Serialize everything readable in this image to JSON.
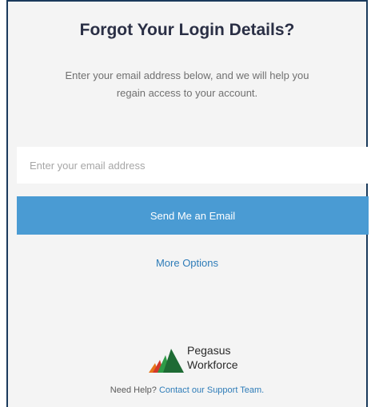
{
  "page": {
    "title": "Forgot Your Login Details?",
    "subtitle": "Enter your email address below, and we will help you regain access to your account."
  },
  "form": {
    "email_placeholder": "Enter your email address",
    "email_value": "",
    "submit_label": "Send Me an Email",
    "more_options_label": "More Options"
  },
  "brand": {
    "name_line1": "Pegasus",
    "name_line2": "Workforce",
    "logo_icon": "pegasus-mountain-logo",
    "colors": {
      "green": "#2e9b47",
      "orange": "#e8751a",
      "red": "#d3382b",
      "dark_green": "#1e6b34"
    }
  },
  "footer": {
    "help_prefix": "Need Help?",
    "help_link": "Contact our Support Team."
  },
  "colors": {
    "button": "#4a9bd3",
    "link": "#2e7cb8",
    "title": "#2a2f45",
    "background": "#f4f4f4"
  }
}
